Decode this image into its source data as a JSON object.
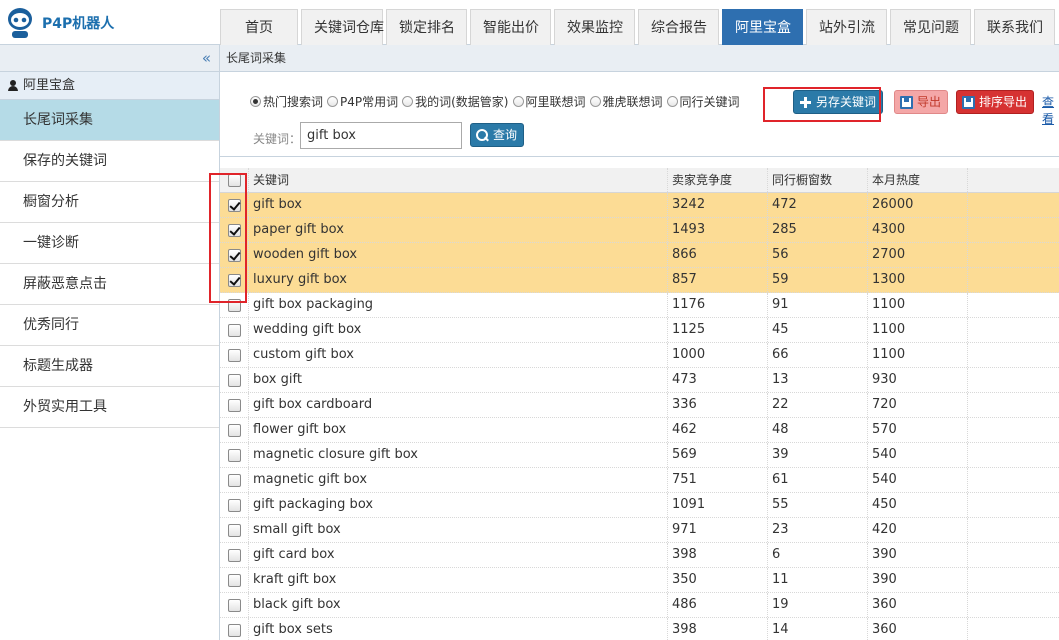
{
  "app": {
    "logo_text": "P4P机器人"
  },
  "nav": {
    "tabs": [
      "首页",
      "关键词仓库",
      "锁定排名",
      "智能出价",
      "效果监控",
      "综合报告",
      "阿里宝盒",
      "站外引流",
      "常见问题",
      "联系我们"
    ],
    "active_index": 6
  },
  "sidebar": {
    "collapse_glyph": "«",
    "section_title": "阿里宝盒",
    "items": [
      "长尾词采集",
      "保存的关键词",
      "橱窗分析",
      "一键诊断",
      "屏蔽恶意点击",
      "优秀同行",
      "标题生成器",
      "外贸实用工具"
    ],
    "active_index": 0
  },
  "content": {
    "title": "长尾词采集"
  },
  "filter": {
    "radios": [
      "热门搜索词",
      "P4P常用词",
      "我的词(数据管家)",
      "阿里联想词",
      "雅虎联想词",
      "同行关键词"
    ],
    "selected_index": 0,
    "save_label": "另存关键词",
    "export_label": "导出",
    "sort_export_label": "排序导出",
    "view_link": "查看",
    "keyword_label": "关键词：",
    "keyword_value": "gift box",
    "search_label": "查询"
  },
  "table": {
    "headers": {
      "keyword": "关键词",
      "competition": "卖家竞争度",
      "windows": "同行橱窗数",
      "heat": "本月热度"
    },
    "rows": [
      {
        "keyword": "gift box",
        "competition": "3242",
        "windows": "472",
        "heat": "26000",
        "checked": true
      },
      {
        "keyword": "paper gift box",
        "competition": "1493",
        "windows": "285",
        "heat": "4300",
        "checked": true
      },
      {
        "keyword": "wooden gift box",
        "competition": "866",
        "windows": "56",
        "heat": "2700",
        "checked": true
      },
      {
        "keyword": "luxury gift box",
        "competition": "857",
        "windows": "59",
        "heat": "1300",
        "checked": true
      },
      {
        "keyword": "gift box packaging",
        "competition": "1176",
        "windows": "91",
        "heat": "1100",
        "checked": false
      },
      {
        "keyword": "wedding gift box",
        "competition": "1125",
        "windows": "45",
        "heat": "1100",
        "checked": false
      },
      {
        "keyword": "custom gift box",
        "competition": "1000",
        "windows": "66",
        "heat": "1100",
        "checked": false
      },
      {
        "keyword": "box gift",
        "competition": "473",
        "windows": "13",
        "heat": "930",
        "checked": false
      },
      {
        "keyword": "gift box cardboard",
        "competition": "336",
        "windows": "22",
        "heat": "720",
        "checked": false
      },
      {
        "keyword": "flower gift box",
        "competition": "462",
        "windows": "48",
        "heat": "570",
        "checked": false
      },
      {
        "keyword": "magnetic closure gift box",
        "competition": "569",
        "windows": "39",
        "heat": "540",
        "checked": false
      },
      {
        "keyword": "magnetic gift box",
        "competition": "751",
        "windows": "61",
        "heat": "540",
        "checked": false
      },
      {
        "keyword": "gift packaging box",
        "competition": "1091",
        "windows": "55",
        "heat": "450",
        "checked": false
      },
      {
        "keyword": "small gift box",
        "competition": "971",
        "windows": "23",
        "heat": "420",
        "checked": false
      },
      {
        "keyword": "gift card box",
        "competition": "398",
        "windows": "6",
        "heat": "390",
        "checked": false
      },
      {
        "keyword": "kraft gift box",
        "competition": "350",
        "windows": "11",
        "heat": "390",
        "checked": false
      },
      {
        "keyword": "black gift box",
        "competition": "486",
        "windows": "19",
        "heat": "360",
        "checked": false
      },
      {
        "keyword": "gift box sets",
        "competition": "398",
        "windows": "14",
        "heat": "360",
        "checked": false
      }
    ]
  },
  "colors": {
    "accent": "#2e6fb0",
    "selected_row": "#fcdc95",
    "highlight": "#e0242a",
    "sidebar_active": "#b5dbe7"
  }
}
